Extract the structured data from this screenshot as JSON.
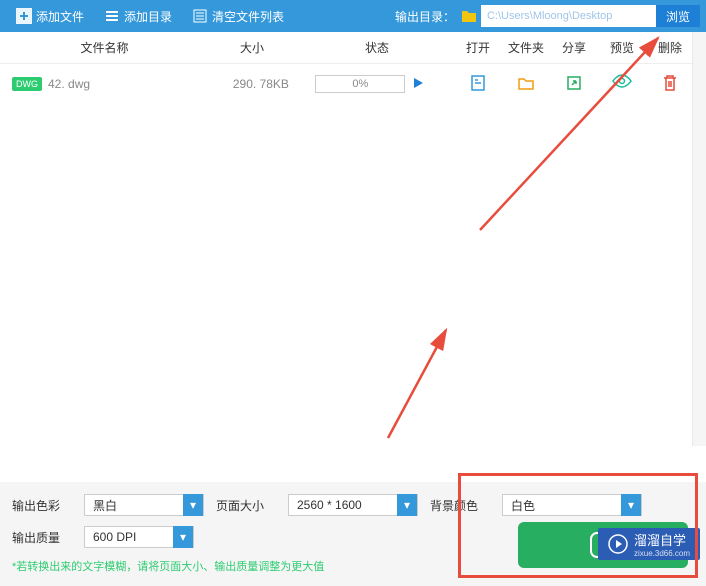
{
  "toolbar": {
    "add_file": "添加文件",
    "add_dir": "添加目录",
    "clear_list": "清空文件列表",
    "output_dir_label": "输出目录：",
    "output_path": "C:\\Users\\Mloong\\Desktop",
    "browse": "浏览"
  },
  "columns": {
    "name": "文件名称",
    "size": "大小",
    "status": "状态",
    "open": "打开",
    "folder": "文件夹",
    "share": "分享",
    "preview": "预览",
    "delete": "删除"
  },
  "files": [
    {
      "badge": "DWG",
      "name": "42. dwg",
      "size": "290. 78KB",
      "progress": "0%"
    }
  ],
  "settings": {
    "color_label": "输出色彩",
    "color_value": "黑白",
    "page_label": "页面大小",
    "page_value": "2560 * 1600",
    "bg_label": "背景颜色",
    "bg_value": "白色",
    "quality_label": "输出质量",
    "quality_value": "600 DPI",
    "hint": "*若转换出来的文字模糊，请将页面大小、输出质量调整为更大值"
  },
  "overlay": {
    "brand": "溜溜自学",
    "sub": "zixue.3d66.com"
  }
}
